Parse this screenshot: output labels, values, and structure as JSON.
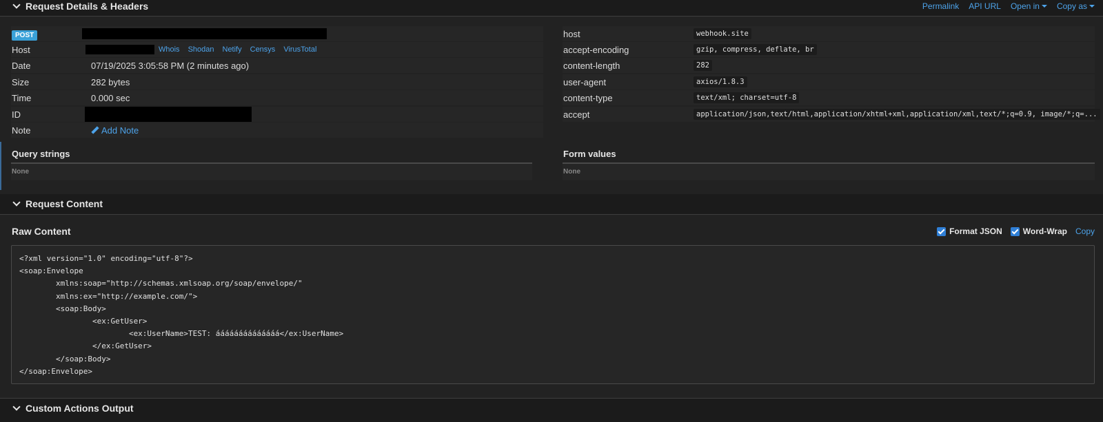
{
  "sections": {
    "details_title": "Request Details & Headers",
    "content_title": "Request Content",
    "actions_title": "Custom Actions Output"
  },
  "header_links": [
    "Permalink",
    "API URL",
    "Open in",
    "Copy as"
  ],
  "details": {
    "method": "POST",
    "host_label": "Host",
    "lookup_links": [
      "Whois",
      "Shodan",
      "Netify",
      "Censys",
      "VirusTotal"
    ],
    "date_label": "Date",
    "date_value": "07/19/2025 3:05:58 PM (2 minutes ago)",
    "size_label": "Size",
    "size_value": "282 bytes",
    "time_label": "Time",
    "time_value": "0.000 sec",
    "id_label": "ID",
    "note_label": "Note",
    "add_note": "Add Note"
  },
  "headers": [
    {
      "key": "host",
      "value": "webhook.site"
    },
    {
      "key": "accept-encoding",
      "value": "gzip, compress, deflate, br"
    },
    {
      "key": "content-length",
      "value": "282"
    },
    {
      "key": "user-agent",
      "value": "axios/1.8.3"
    },
    {
      "key": "content-type",
      "value": "text/xml; charset=utf-8"
    },
    {
      "key": "accept",
      "value": "application/json,text/html,application/xhtml+xml,application/xml,text/*;q=0.9, image/*;q=..."
    }
  ],
  "query_strings": {
    "title": "Query strings",
    "empty": "None"
  },
  "form_values": {
    "title": "Form values",
    "empty": "None"
  },
  "raw": {
    "title": "Raw Content",
    "format_json": "Format JSON",
    "word_wrap": "Word-Wrap",
    "copy": "Copy",
    "lines": [
      "<?xml version=\"1.0\" encoding=\"utf-8\"?>",
      "<soap:Envelope",
      "        xmlns:soap=\"http://schemas.xmlsoap.org/soap/envelope/\"",
      "        xmlns:ex=\"http://example.com/\">",
      "        <soap:Body>",
      "                <ex:GetUser>",
      "                        <ex:UserName>TEST: áááááááááááááá</ex:UserName>",
      "                </ex:GetUser>",
      "        </soap:Body>",
      "</soap:Envelope>"
    ]
  }
}
